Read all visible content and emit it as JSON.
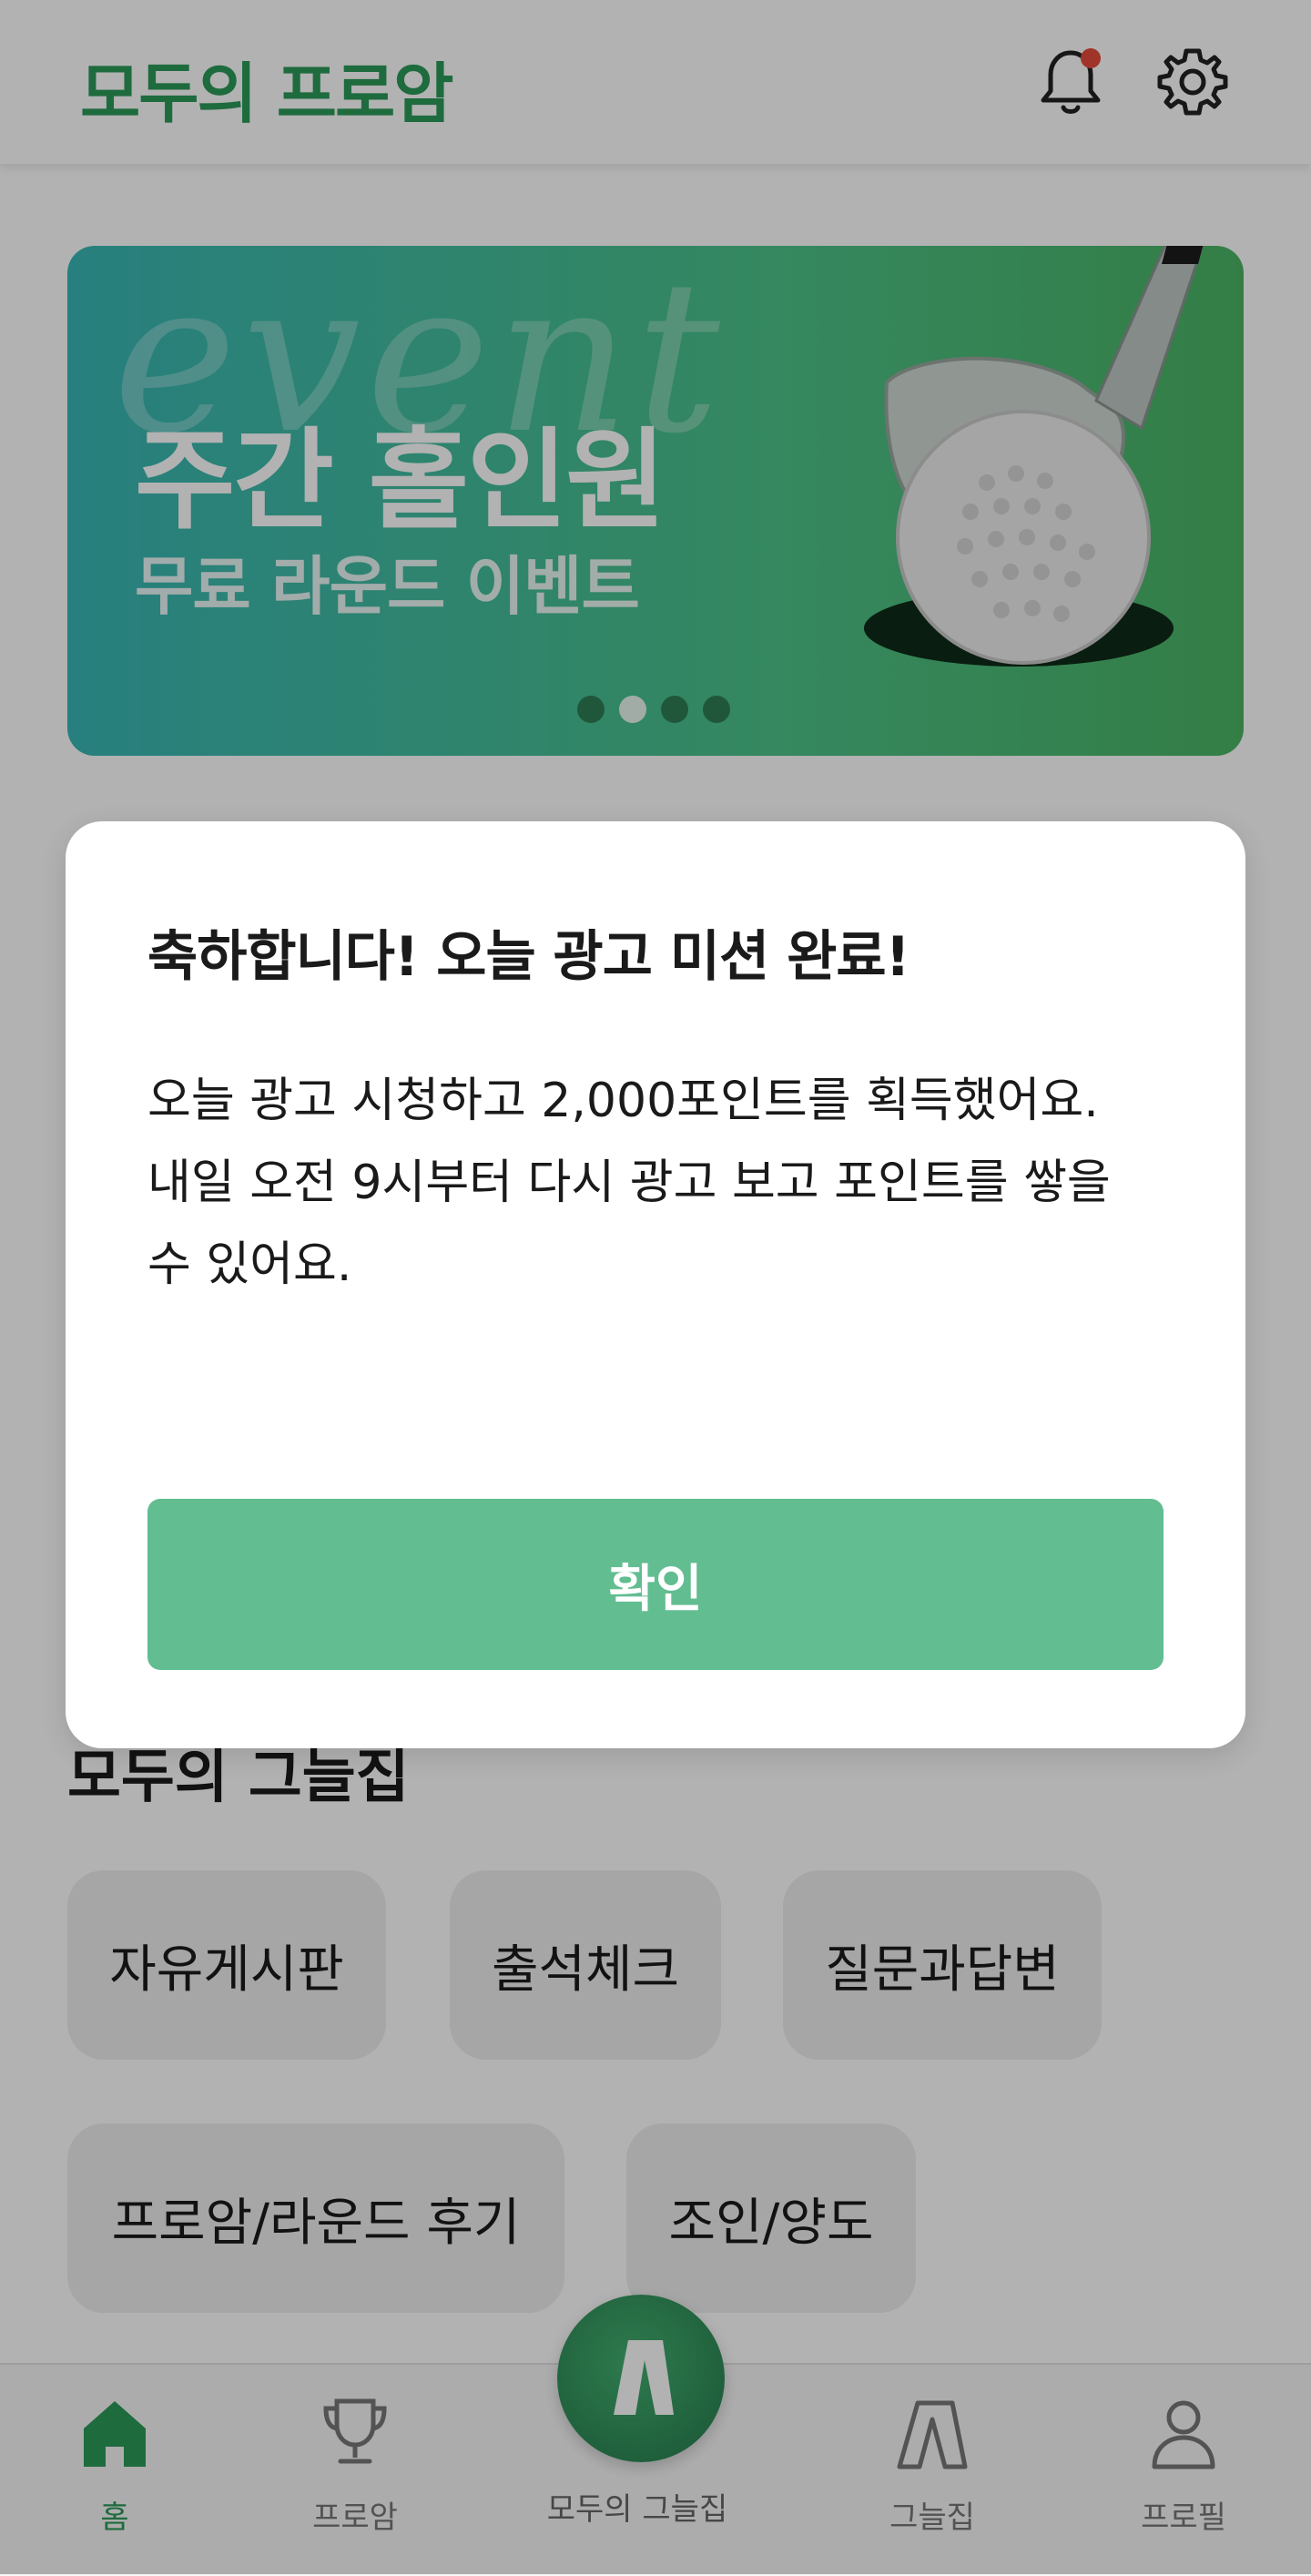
{
  "header": {
    "logo": "모두의 프로암",
    "notification_badge_color": "#e54b3c",
    "icons": [
      "bell-icon",
      "gear-icon"
    ]
  },
  "banner": {
    "script_text": "event",
    "title": "주간 홀인원",
    "subtitle": "무료 라운드 이벤트",
    "dots_total": 4,
    "dots_active_index": 1
  },
  "section": {
    "title": "모두의 그늘집",
    "chips": [
      "자유게시판",
      "출석체크",
      "질문과답변",
      "프로암/라운드 후기",
      "조인/양도"
    ]
  },
  "bottom_nav": {
    "items": [
      {
        "label": "홈",
        "icon": "home-icon",
        "active": true
      },
      {
        "label": "프로암",
        "icon": "trophy-icon",
        "active": false
      },
      {
        "label": "그늘집",
        "icon": "tent-icon",
        "active": false
      },
      {
        "label": "프로필",
        "icon": "person-icon",
        "active": false
      }
    ],
    "center": {
      "label": "모두의 그늘집",
      "icon": "app-logo-icon"
    }
  },
  "modal": {
    "title": "축하합니다! 오늘 광고 미션 완료!",
    "body_line1": "오늘 광고 시청하고 2,000포인트를 획득했어요.",
    "body_line2": "내일 오전 9시부터 다시 광고 보고 포인트를 쌓을 수 있어요.",
    "confirm_label": "확인"
  },
  "colors": {
    "brand_green": "#2b9a5a",
    "confirm_button": "#62bd91",
    "overlay": "rgba(0,0,0,0.30)"
  }
}
